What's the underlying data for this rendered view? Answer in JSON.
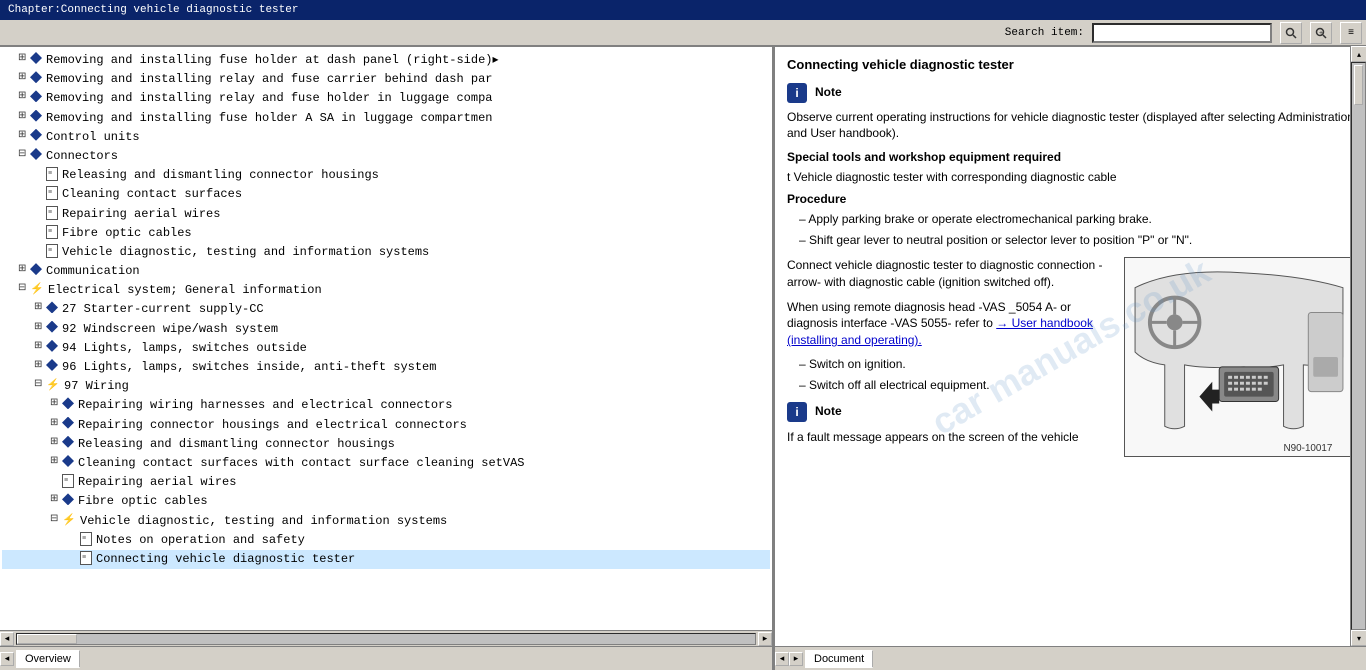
{
  "titlebar": {
    "text": "Chapter:Connecting vehicle diagnostic tester"
  },
  "toolbar": {
    "search_label": "Search item:",
    "search_value": "",
    "search_placeholder": ""
  },
  "tree": {
    "items": [
      {
        "id": 1,
        "indent": 1,
        "type": "book",
        "expand": true,
        "text": "Removing and installing fuse holder at dash panel (right-side)"
      },
      {
        "id": 2,
        "indent": 1,
        "type": "book",
        "expand": true,
        "text": "Removing and installing relay and fuse carrier behind dash pa"
      },
      {
        "id": 3,
        "indent": 1,
        "type": "book",
        "expand": true,
        "text": "Removing and installing relay and fuse holder in luggage comp"
      },
      {
        "id": 4,
        "indent": 1,
        "type": "book",
        "expand": true,
        "text": "Removing and installing fuse holder A SA in luggage compartme"
      },
      {
        "id": 5,
        "indent": 1,
        "type": "book",
        "expand": false,
        "text": "Control units"
      },
      {
        "id": 6,
        "indent": 1,
        "type": "book",
        "expand": true,
        "text": "Connectors"
      },
      {
        "id": 7,
        "indent": 2,
        "type": "page",
        "text": "Releasing and dismantling connector housings"
      },
      {
        "id": 8,
        "indent": 2,
        "type": "page",
        "text": "Cleaning contact surfaces"
      },
      {
        "id": 9,
        "indent": 2,
        "type": "page",
        "text": "Repairing aerial wires"
      },
      {
        "id": 10,
        "indent": 2,
        "type": "page",
        "text": "Fibre optic cables"
      },
      {
        "id": 11,
        "indent": 2,
        "type": "page",
        "text": "Vehicle diagnostic, testing and information systems"
      },
      {
        "id": 12,
        "indent": 1,
        "type": "book",
        "expand": false,
        "text": "Communication"
      },
      {
        "id": 13,
        "indent": 1,
        "type": "book",
        "expand": false,
        "text": "Electrical system; General information"
      },
      {
        "id": 14,
        "indent": 1,
        "type": "book",
        "expand": true,
        "text": "27 Starter-current supply-CC"
      },
      {
        "id": 15,
        "indent": 1,
        "type": "book",
        "expand": false,
        "text": "92 Windscreen wipe/wash system"
      },
      {
        "id": 16,
        "indent": 1,
        "type": "book",
        "expand": false,
        "text": "94 Lights, lamps, switches outside"
      },
      {
        "id": 17,
        "indent": 1,
        "type": "book",
        "expand": false,
        "text": "96 Lights, lamps, switches inside, anti-theft system"
      },
      {
        "id": 18,
        "indent": 1,
        "type": "book",
        "expand": true,
        "text": "97 Wiring"
      },
      {
        "id": 19,
        "indent": 2,
        "type": "book",
        "expand": true,
        "text": "Repairing wiring harnesses and electrical connectors"
      },
      {
        "id": 20,
        "indent": 2,
        "type": "book",
        "expand": true,
        "text": "Repairing connector housings and electrical connectors"
      },
      {
        "id": 21,
        "indent": 2,
        "type": "book",
        "expand": true,
        "text": "Releasing and dismantling connector housings"
      },
      {
        "id": 22,
        "indent": 2,
        "type": "book",
        "expand": true,
        "text": "Cleaning contact surfaces with contact surface cleaning setVAS"
      },
      {
        "id": 23,
        "indent": 2,
        "type": "page",
        "text": "Repairing aerial wires"
      },
      {
        "id": 24,
        "indent": 2,
        "type": "book",
        "expand": true,
        "text": "Fibre optic cables"
      },
      {
        "id": 25,
        "indent": 2,
        "type": "book",
        "expand": true,
        "text": "Vehicle diagnostic, testing and information systems"
      },
      {
        "id": 26,
        "indent": 3,
        "type": "page",
        "text": "Notes on operation and safety"
      },
      {
        "id": 27,
        "indent": 3,
        "type": "page",
        "active": true,
        "text": "Connecting vehicle diagnostic tester"
      }
    ]
  },
  "right_panel": {
    "title": "Connecting vehicle diagnostic tester",
    "note1_icon": "i",
    "note1_label": "Note",
    "note1_text": "Observe current operating instructions for vehicle diagnostic tester (displayed after selecting Administration and User handbook).",
    "special_tools_label": "Special tools and workshop equipment required",
    "tool_item": "t  Vehicle diagnostic tester with corresponding diagnostic cable",
    "procedure_label": "Procedure",
    "step1": "–  Apply parking brake or operate electromechanical parking brake.",
    "step2": "–  Shift gear lever to neutral position or selector lever to position \"P\" or \"N\".",
    "connect_text": "Connect vehicle diagnostic tester to diagnostic connection - arrow- with diagnostic cable (ignition switched off).",
    "remote_text": "When using remote diagnosis head -VAS 5054 A- or diagnosis interface -VAS 5055- refer to",
    "link_text": "→ User handbook (installing and operating).",
    "step3": "–  Switch on ignition.",
    "step4": "–  Switch off all electrical equipment.",
    "note2_icon": "i",
    "note2_label": "Note",
    "note2_text": "If a fault message appears on the screen of the vehicle",
    "diagram_label": "N90-10017",
    "arrow_annotation": "arrow - With diagnostic"
  },
  "bottom": {
    "tab_overview": "Overview",
    "tab_document": "Document"
  }
}
